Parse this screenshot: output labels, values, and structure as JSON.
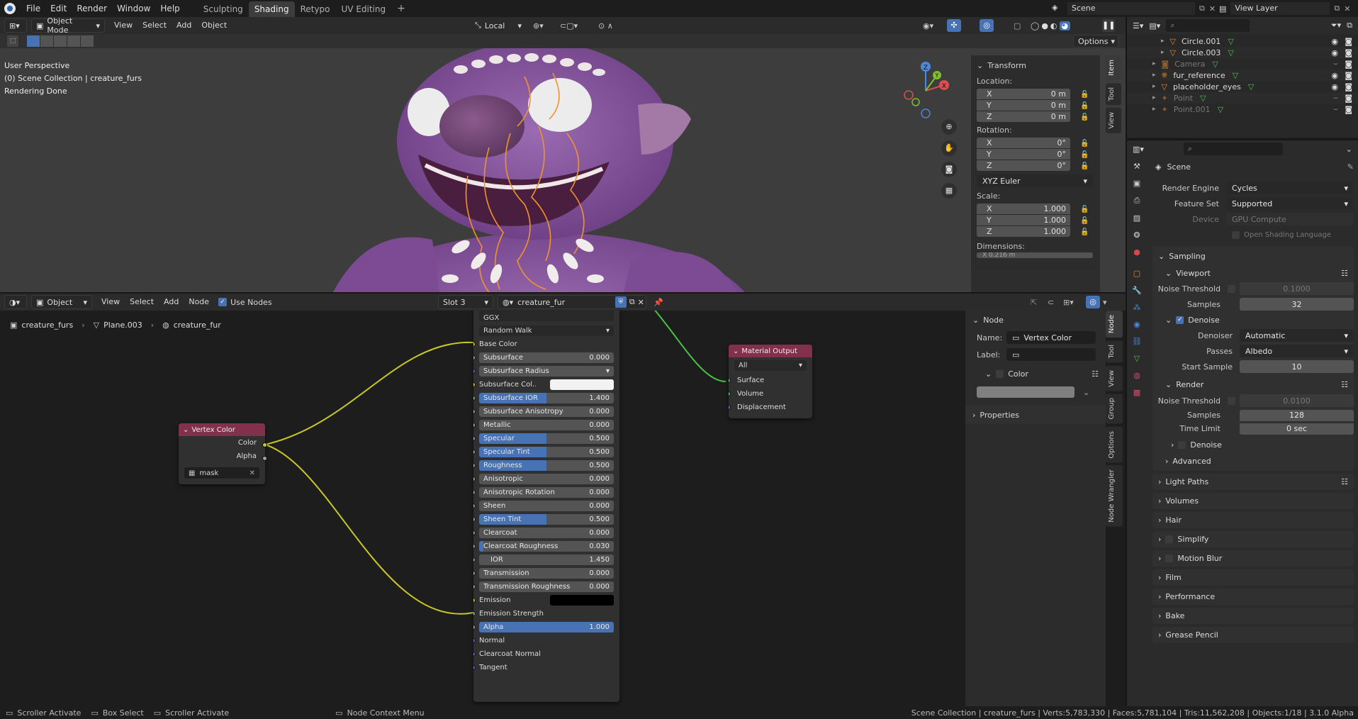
{
  "topbar": {
    "menus": [
      "File",
      "Edit",
      "Render",
      "Window",
      "Help"
    ],
    "workspaces": [
      "Sculpting",
      "Shading",
      "Retypo",
      "UV Editing"
    ],
    "active_workspace": "Shading",
    "add_tab": "+",
    "scene": "Scene",
    "view_layer": "View Layer"
  },
  "viewport_header": {
    "mode": "Object Mode",
    "menus": [
      "View",
      "Select",
      "Add",
      "Object"
    ],
    "transform_orientation": "Local",
    "options": "Options"
  },
  "viewport": {
    "perspective": "User Perspective",
    "collection": "(0) Scene Collection | creature_furs",
    "status": "Rendering Done",
    "gizmo_axes": {
      "x": "X",
      "y": "Y",
      "z": "Z"
    }
  },
  "transform_panel": {
    "title": "Transform",
    "location_label": "Location:",
    "location": [
      {
        "axis": "X",
        "value": "0 m"
      },
      {
        "axis": "Y",
        "value": "0 m"
      },
      {
        "axis": "Z",
        "value": "0 m"
      }
    ],
    "rotation_label": "Rotation:",
    "rotation": [
      {
        "axis": "X",
        "value": "0°"
      },
      {
        "axis": "Y",
        "value": "0°"
      },
      {
        "axis": "Z",
        "value": "0°"
      }
    ],
    "rotation_mode": "XYZ Euler",
    "scale_label": "Scale:",
    "scale": [
      {
        "axis": "X",
        "value": "1.000"
      },
      {
        "axis": "Y",
        "value": "1.000"
      },
      {
        "axis": "Z",
        "value": "1.000"
      }
    ],
    "dimensions_label": "Dimensions:",
    "dimensions_partial": "X  0.216 m"
  },
  "sidebar_tabs_viewport": [
    "Item",
    "Tool",
    "View"
  ],
  "outliner": {
    "rows": [
      {
        "name": "Circle.001",
        "dim": false
      },
      {
        "name": "Circle.003",
        "dim": false
      },
      {
        "name": "Camera",
        "dim": true
      },
      {
        "name": "fur_reference",
        "dim": false
      },
      {
        "name": "placeholder_eyes",
        "dim": false
      },
      {
        "name": "Point",
        "dim": true
      },
      {
        "name": "Point.001",
        "dim": true
      }
    ]
  },
  "node_header": {
    "editor": "Object",
    "menus": [
      "View",
      "Select",
      "Add",
      "Node"
    ],
    "use_nodes": "Use Nodes",
    "slot": "Slot 3",
    "material": "creature_fur"
  },
  "breadcrumb": [
    "creature_furs",
    "Plane.003",
    "creature_fur"
  ],
  "vertex_color_node": {
    "title": "Vertex Color",
    "outputs": [
      "Color",
      "Alpha"
    ],
    "layer": "mask"
  },
  "principled_node": {
    "distribution": "GGX",
    "subsurface_method": "Random Walk",
    "rows": [
      {
        "type": "label",
        "label": "Base Color",
        "sock": "#c7c729"
      },
      {
        "type": "slider",
        "label": "Subsurface",
        "value": "0.000",
        "fill": 0,
        "sock": "#a1a1a1"
      },
      {
        "type": "dropdown",
        "label": "Subsurface Radius",
        "sock": "#6363c7"
      },
      {
        "type": "color",
        "label": "Subsurface Col...",
        "color": "#f2f2f2",
        "sock": "#c7c729"
      },
      {
        "type": "slider",
        "label": "Subsurface IOR",
        "value": "1.400",
        "fill": 0.5,
        "sock": "#a1a1a1"
      },
      {
        "type": "slider",
        "label": "Subsurface Anisotropy",
        "value": "0.000",
        "fill": 0,
        "sock": "#a1a1a1"
      },
      {
        "type": "slider",
        "label": "Metallic",
        "value": "0.000",
        "fill": 0,
        "sock": "#a1a1a1"
      },
      {
        "type": "slider",
        "label": "Specular",
        "value": "0.500",
        "fill": 0.5,
        "sock": "#a1a1a1"
      },
      {
        "type": "slider",
        "label": "Specular Tint",
        "value": "0.500",
        "fill": 0.5,
        "sock": "#a1a1a1"
      },
      {
        "type": "slider",
        "label": "Roughness",
        "value": "0.500",
        "fill": 0.5,
        "sock": "#a1a1a1"
      },
      {
        "type": "slider",
        "label": "Anisotropic",
        "value": "0.000",
        "fill": 0,
        "sock": "#a1a1a1"
      },
      {
        "type": "slider",
        "label": "Anisotropic Rotation",
        "value": "0.000",
        "fill": 0,
        "sock": "#a1a1a1"
      },
      {
        "type": "slider",
        "label": "Sheen",
        "value": "0.000",
        "fill": 0,
        "sock": "#a1a1a1"
      },
      {
        "type": "slider",
        "label": "Sheen Tint",
        "value": "0.500",
        "fill": 0.5,
        "sock": "#a1a1a1"
      },
      {
        "type": "slider",
        "label": "Clearcoat",
        "value": "0.000",
        "fill": 0,
        "sock": "#a1a1a1"
      },
      {
        "type": "slider",
        "label": "Clearcoat Roughness",
        "value": "0.030",
        "fill": 0.03,
        "sock": "#a1a1a1"
      },
      {
        "type": "slider",
        "label": "IOR",
        "value": "1.450",
        "fill": 0,
        "sock": "#a1a1a1"
      },
      {
        "type": "slider",
        "label": "Transmission",
        "value": "0.000",
        "fill": 0,
        "sock": "#a1a1a1"
      },
      {
        "type": "slider",
        "label": "Transmission Roughness",
        "value": "0.000",
        "fill": 0,
        "sock": "#a1a1a1"
      },
      {
        "type": "color",
        "label": "Emission",
        "color": "#000000",
        "sock": "#c7c729"
      },
      {
        "type": "label",
        "label": "Emission Strength",
        "sock": "#a1a1a1"
      },
      {
        "type": "slider",
        "label": "Alpha",
        "value": "1.000",
        "fill": 1,
        "sock": "#a1a1a1"
      },
      {
        "type": "label",
        "label": "Normal",
        "sock": "#6363c7"
      },
      {
        "type": "label",
        "label": "Clearcoat Normal",
        "sock": "#6363c7"
      },
      {
        "type": "label",
        "label": "Tangent",
        "sock": "#6363c7"
      }
    ]
  },
  "material_output_node": {
    "title": "Material Output",
    "target": "All",
    "inputs": [
      "Surface",
      "Volume",
      "Displacement"
    ]
  },
  "node_sidebar": {
    "section": "Node",
    "name_label": "Name:",
    "name_value": "Vertex Color",
    "label_label": "Label:",
    "color_section": "Color",
    "properties_section": "Properties",
    "tabs": [
      "Node",
      "Tool",
      "View",
      "Group",
      "Options",
      "Node Wrangler"
    ]
  },
  "properties": {
    "context": "Scene",
    "render_engine_label": "Render Engine",
    "render_engine": "Cycles",
    "feature_set_label": "Feature Set",
    "feature_set": "Supported",
    "device_label": "Device",
    "device": "GPU Compute",
    "osl": "Open Shading Language",
    "sampling": "Sampling",
    "viewport": "Viewport",
    "noise_threshold_label": "Noise Threshold",
    "viewport_noise": "0.1000",
    "samples_label": "Samples",
    "viewport_samples": "32",
    "denoise": "Denoise",
    "denoiser_label": "Denoiser",
    "denoiser": "Automatic",
    "passes_label": "Passes",
    "passes": "Albedo",
    "start_sample_label": "Start Sample",
    "start_sample": "10",
    "render": "Render",
    "render_noise": "0.0100",
    "render_samples": "128",
    "time_limit_label": "Time Limit",
    "time_limit": "0 sec",
    "render_denoise": "Denoise",
    "advanced": "Advanced",
    "sections": [
      "Light Paths",
      "Volumes",
      "Hair",
      "Simplify",
      "Motion Blur",
      "Film",
      "Performance",
      "Bake",
      "Grease Pencil"
    ]
  },
  "statusbar": {
    "hints": [
      "Scroller Activate",
      "Box Select",
      "Scroller Activate",
      "Node Context Menu"
    ],
    "stats": "Scene Collection | creature_furs | Verts:5,783,330 | Faces:5,781,104 | Tris:11,562,208 | Objects:1/18 | 3.1.0 Alpha"
  },
  "colors": {
    "accent": "#4772b3",
    "node_header_red": "#83314a",
    "wire_yellow": "#c7c729",
    "wire_green": "#4ac14a",
    "fur_purple": "#8a4fa0"
  }
}
